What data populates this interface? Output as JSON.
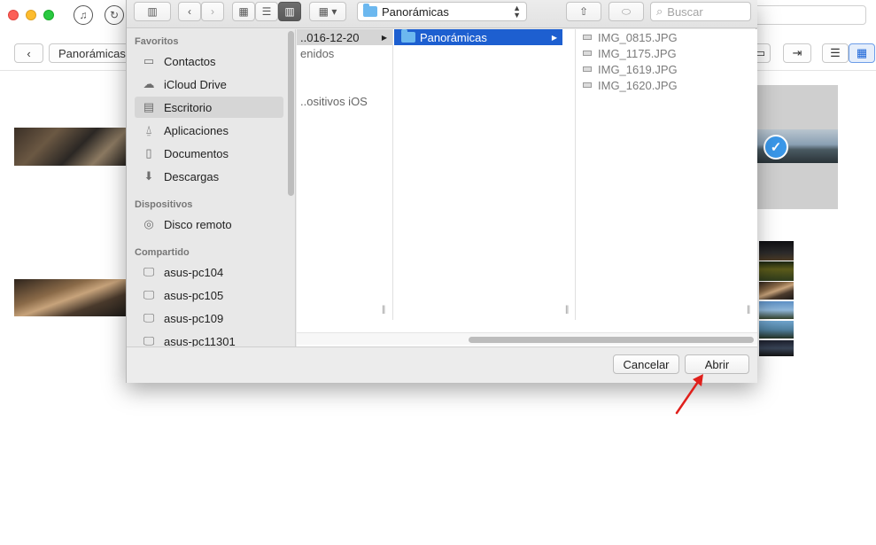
{
  "app": {
    "breadcrumb_label": "Panorámicas"
  },
  "dialog": {
    "toolbar": {
      "path_popup_label": "Panorámicas",
      "search_placeholder": "Buscar"
    },
    "sidebar": {
      "sections": [
        {
          "title": "Favoritos",
          "items": [
            {
              "label": "Contactos",
              "icon": "folder-icon"
            },
            {
              "label": "iCloud Drive",
              "icon": "cloud-icon"
            },
            {
              "label": "Escritorio",
              "icon": "desktop-icon",
              "selected": true
            },
            {
              "label": "Aplicaciones",
              "icon": "applications-icon"
            },
            {
              "label": "Documentos",
              "icon": "documents-icon"
            },
            {
              "label": "Descargas",
              "icon": "downloads-icon"
            }
          ]
        },
        {
          "title": "Dispositivos",
          "items": [
            {
              "label": "Disco remoto",
              "icon": "disc-icon"
            }
          ]
        },
        {
          "title": "Compartido",
          "items": [
            {
              "label": "asus-pc104",
              "icon": "computer-icon"
            },
            {
              "label": "asus-pc105",
              "icon": "computer-icon"
            },
            {
              "label": "asus-pc109",
              "icon": "computer-icon"
            },
            {
              "label": "asus-pc11301",
              "icon": "computer-icon"
            }
          ]
        }
      ]
    },
    "columns": {
      "col1": [
        {
          "label": "..016-12-20",
          "highlight": true
        },
        {
          "label": "enidos"
        },
        {
          "label": ""
        },
        {
          "label": "..ositivos iOS"
        }
      ],
      "col2": [
        {
          "label": "Panorámicas",
          "selected": true
        }
      ],
      "files": [
        "IMG_0815.JPG",
        "IMG_1175.JPG",
        "IMG_1619.JPG",
        "IMG_1620.JPG"
      ]
    },
    "buttons": {
      "cancel_label": "Cancelar",
      "open_label": "Abrir"
    }
  },
  "colors": {
    "selection_blue": "#1d5fd0",
    "accent_arrow": "#e0201c"
  }
}
